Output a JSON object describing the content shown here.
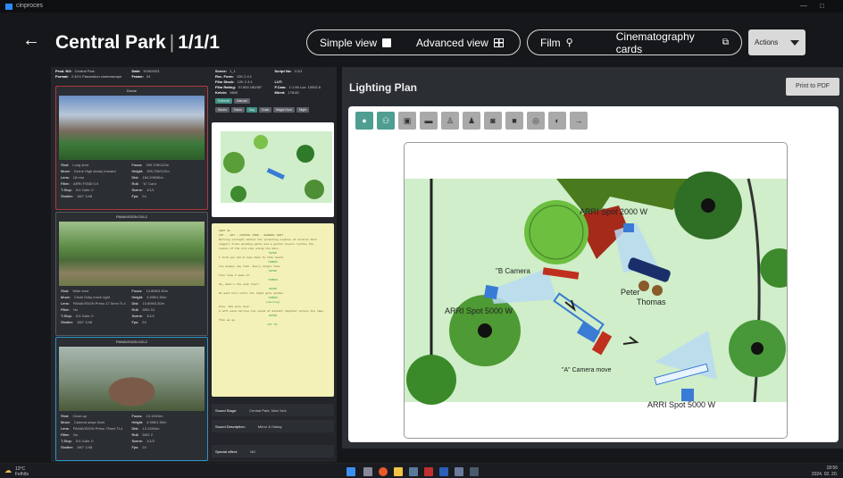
{
  "window": {
    "app_name": "cinproces",
    "min": "—",
    "max": "□"
  },
  "header": {
    "back": "←",
    "title": "Central Park",
    "sep": "|",
    "scene": "1/1/1"
  },
  "view_toggle": {
    "simple": "Simple view",
    "advanced": "Advanced view"
  },
  "mode_toggle": {
    "film": "Film",
    "cards": "Cinematography cards"
  },
  "actions": {
    "label": "Actions"
  },
  "left": {
    "meta": [
      {
        "k": "Prod. NO:",
        "v": "Central Park"
      },
      {
        "k": "Date:",
        "v": "9/15/2023"
      },
      {
        "k": "Format:",
        "v": "2.40:1 Panavision cinemascope"
      },
      {
        "k": "Frame:",
        "v": "24"
      }
    ],
    "shots": [
      {
        "caption": "Drone",
        "rows": [
          {
            "k": "Shot:",
            "v": "Long shot"
          },
          {
            "k": "Focus:",
            "v": "399,70ft/122m"
          },
          {
            "k": "Move:",
            "v": "Drone High slowly forward"
          },
          {
            "k": "Height:",
            "v": "399,70ft/122m"
          },
          {
            "k": "Lens:",
            "v": "18 mm"
          },
          {
            "k": "Dist:",
            "v": "184,20ft/56m"
          },
          {
            "k": "Filter:",
            "v": "ARRI FSND 0.9"
          },
          {
            "k": "Roll:",
            "v": "\"A\" Card"
          },
          {
            "k": "T-Stop:",
            "v": "5.6   Gain: 0"
          },
          {
            "k": "Scene:",
            "v": "1/1/1"
          },
          {
            "k": "Shutter:",
            "v": "180°   1/48"
          },
          {
            "k": "Fps:",
            "v": "24"
          }
        ]
      },
      {
        "caption": "PANAVISION DXL2",
        "rows": [
          {
            "k": "Shot:",
            "v": "Wide shot"
          },
          {
            "k": "Focus:",
            "v": "10.80ft/3.30m"
          },
          {
            "k": "Move:",
            "v": "Circle Dolly move right"
          },
          {
            "k": "Height:",
            "v": "4.90ft/1.50m"
          },
          {
            "k": "Lens:",
            "v": "PANAVISION Primo 17.5mm TL4"
          },
          {
            "k": "Dist:",
            "v": "10.80ft/3.30m"
          },
          {
            "k": "Filter:",
            "v": "No"
          },
          {
            "k": "Roll:",
            "v": "DBX 01"
          },
          {
            "k": "T-Stop:",
            "v": "5.6   Gain: 0"
          },
          {
            "k": "Scene:",
            "v": "1/1/2"
          },
          {
            "k": "Shutter:",
            "v": "180°   1/48"
          },
          {
            "k": "Fps:",
            "v": "24"
          }
        ]
      },
      {
        "caption": "PANAVISION DXL2",
        "rows": [
          {
            "k": "Shot:",
            "v": "Close-up"
          },
          {
            "k": "Focus:",
            "v": "13.12ft/4m"
          },
          {
            "k": "Move:",
            "v": "Camera stays fixed"
          },
          {
            "k": "Height:",
            "v": "4.90ft/1.50m"
          },
          {
            "k": "Lens:",
            "v": "PANAVISION Primo 75mm TL4"
          },
          {
            "k": "Dist:",
            "v": "13.12ft/4m"
          },
          {
            "k": "Filter:",
            "v": "No"
          },
          {
            "k": "Roll:",
            "v": "DBX 2"
          },
          {
            "k": "T-Stop:",
            "v": "5.6   Gain: 0"
          },
          {
            "k": "Scene:",
            "v": "1/1/3"
          },
          {
            "k": "Shutter:",
            "v": "180°   1/48"
          },
          {
            "k": "Fps:",
            "v": "24"
          }
        ]
      }
    ]
  },
  "mid": {
    "info": [
      {
        "k": "Scene:",
        "v": "1_1"
      },
      {
        "k": "Script No:",
        "v": "1/1/1"
      },
      {
        "k": "Rec. Form:",
        "v": "12K 2.4:1"
      },
      {
        "k": "",
        "v": ""
      },
      {
        "k": "Film Stock:",
        "v": "12K 2.4:1"
      },
      {
        "k": "LUT:",
        "v": ""
      },
      {
        "k": "Film Rating:",
        "v": "EI 800 180/30°"
      },
      {
        "k": "F.Cam:",
        "v": "1:1.96  Lux: 10002.6"
      },
      {
        "k": "Kelvin:",
        "v": "5600"
      },
      {
        "k": "Mired:",
        "v": "178.60"
      }
    ],
    "tags1": [
      "External",
      "Internal"
    ],
    "tags2": [
      "Studio",
      "Dawn",
      "Day",
      "Dusk",
      "Magic Hour",
      "Night"
    ],
    "script_lines": [
      "SHOT 4A",
      "INT. - DAY - CENTRAL PARK - GENERAL SHOT",
      "Morning sunlight bathes the sprawling expanse of Central Park.",
      "Joggers trace winding paths and a gentle breeze rustles the",
      "leaves of the old elms along the mall.",
      "PETER",
      "I told you she'd come back to this bench.",
      "THOMAS",
      "You always say that. Every single time.",
      "PETER",
      "This time I mean it.",
      "THOMAS",
      "So, what's the plan then?",
      "PETER",
      "We wait here until the light gets golden.",
      "THOMAS",
      "(smiling)",
      "Fine. One more hour.",
      "A soft wind carries the sound of distant laughter across the lawn.",
      "PETER",
      "Then we go.",
      "CUT TO:"
    ],
    "sound_stage": {
      "k": "Sound Stage:",
      "v": "Central Park, New York"
    },
    "sound_desc": {
      "k": "Sound Description:",
      "v": "Mirror & Dialog"
    },
    "special": {
      "k": "Special effect:",
      "v": "NO"
    }
  },
  "right": {
    "title": "Lighting Plan",
    "print": "Print to PDF",
    "tools": [
      "bulb-icon",
      "people-icon",
      "image-icon",
      "car-icon",
      "person-icon",
      "actor-icon",
      "camera-icon",
      "video-icon",
      "lamp-icon",
      "contrast-icon",
      "arrow-right-icon"
    ],
    "tool_glyphs": [
      "●",
      "⚇",
      "▣",
      "▬",
      "♙",
      "♟",
      "◙",
      "■",
      "◎",
      "◐",
      "→"
    ],
    "plan_labels": {
      "arri2000": "ARRI Spot 2000 W",
      "bcam": "\"B Camera",
      "peter": "Peter",
      "thomas": "Thomas",
      "arri5000a": "ARRI Spot 5000 W",
      "acam": "\"A\" Camera move",
      "arri5000b": "ARRI Spot 5000 W"
    }
  },
  "taskbar": {
    "temp": "13°C",
    "cond": "Felhős",
    "time": "18:56",
    "date": "2024. 02. 20."
  },
  "colors": {
    "accent": "#4e9e92",
    "shot_red": "#b23a3a",
    "shot_blue": "#2a97c8",
    "grass": "#cfeec9"
  }
}
